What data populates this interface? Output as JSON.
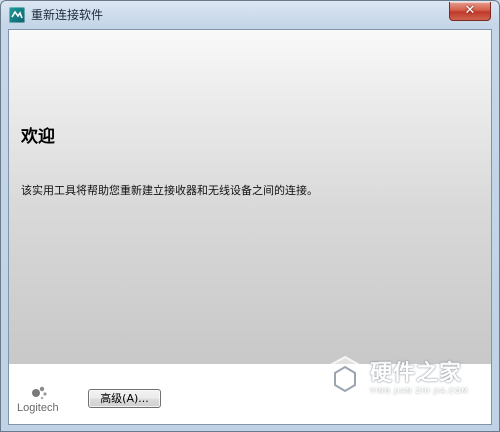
{
  "window": {
    "title": "重新连接软件",
    "close_glyph": "✕",
    "icon": "logitech-app-icon"
  },
  "main": {
    "heading": "欢迎",
    "description": "该实用工具将帮助您重新建立接收器和无线设备之间的连接。"
  },
  "footer": {
    "logo_text": "Logitech",
    "advanced_button_label": "高级(A)..."
  },
  "watermark": {
    "title": "硬件之家",
    "subtitle": "YING JIAN ZHI JIA.COM"
  },
  "colors": {
    "close_button": "#c0392b",
    "title_bar": "#c5d6e8",
    "footer_background": "#ffffff"
  }
}
